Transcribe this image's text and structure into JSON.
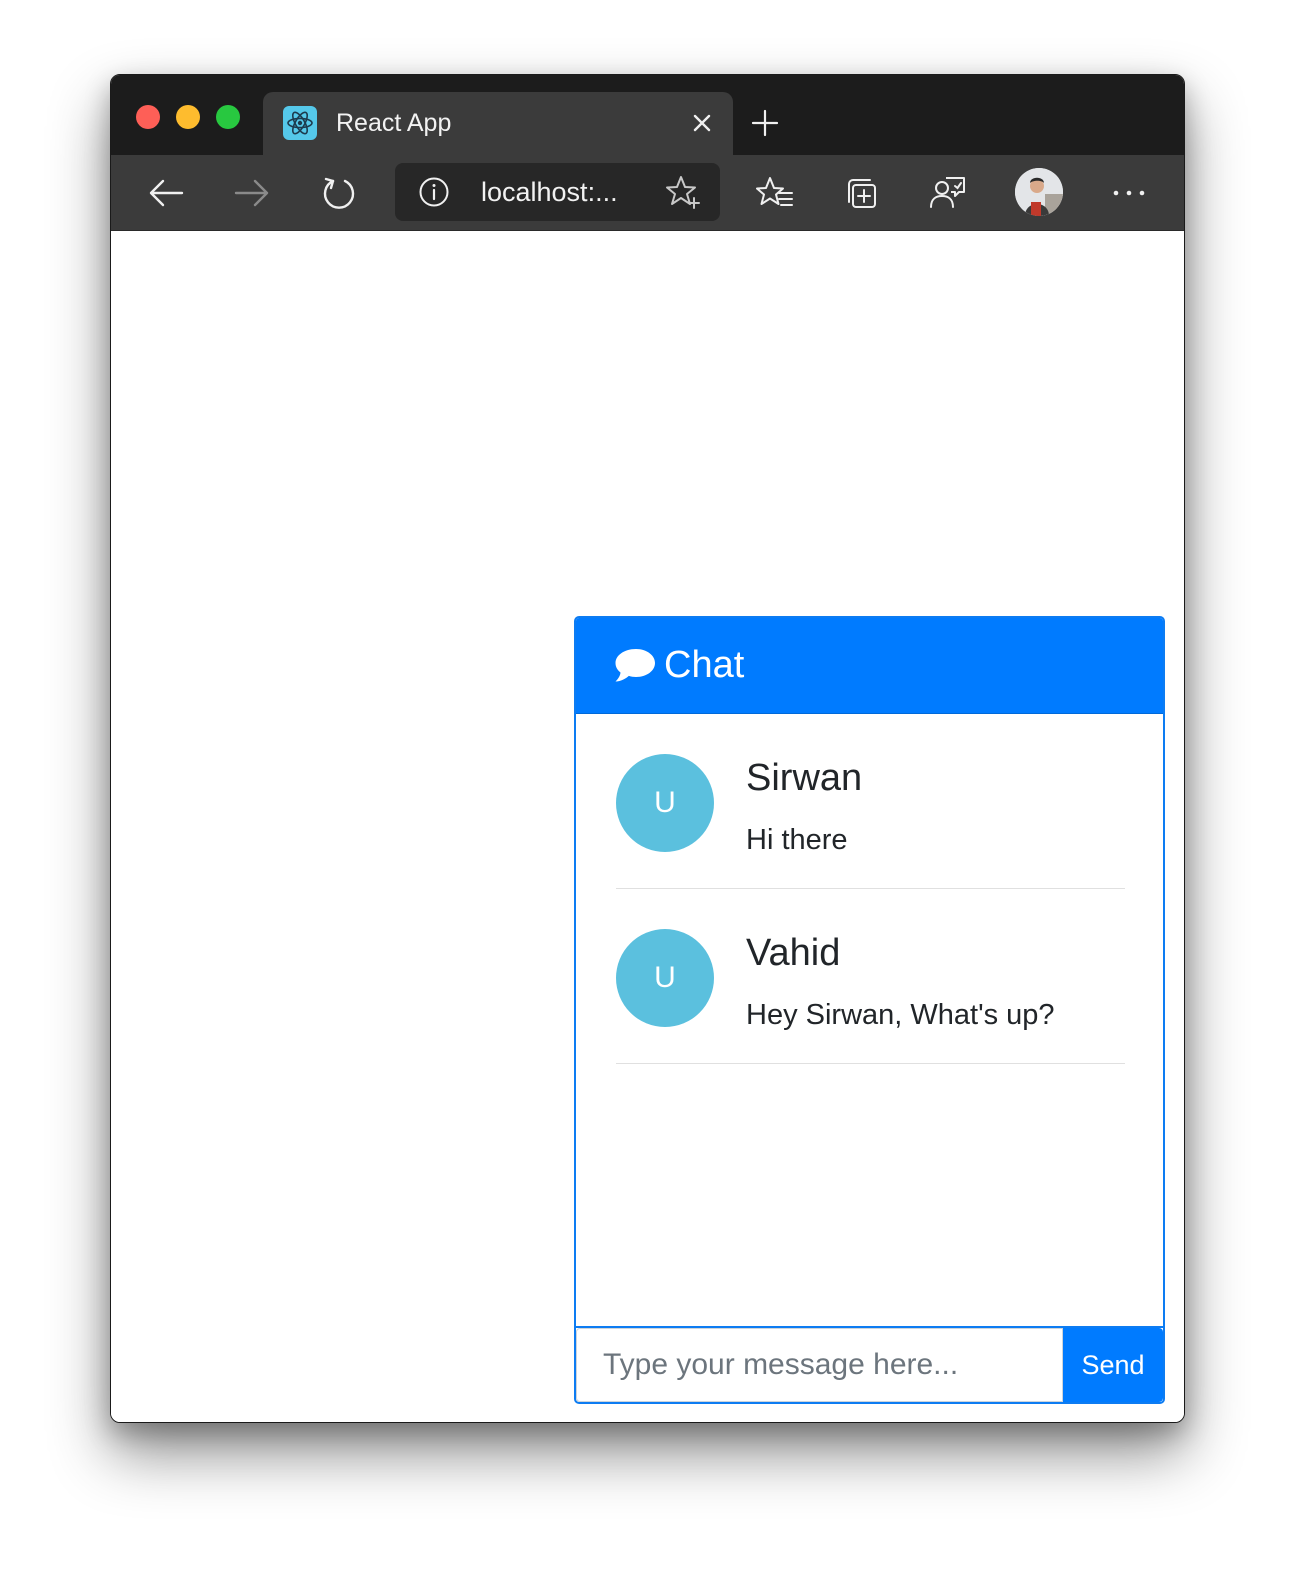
{
  "browser": {
    "tab": {
      "title": "React App",
      "favicon": "react-logo-icon"
    },
    "address": {
      "url": "localhost:..."
    },
    "toolbar_icons": [
      "back-arrow-icon",
      "forward-arrow-icon",
      "reload-icon",
      "info-icon",
      "add-favorite-star-icon",
      "favorites-icon",
      "collections-icon",
      "feedback-icon",
      "profile-avatar",
      "more-icon"
    ]
  },
  "chat": {
    "title": "Chat",
    "header_icon": "speech-bubble-icon",
    "accent_color": "#007bff",
    "avatar_color": "#5bc0de",
    "messages": [
      {
        "avatar": "U",
        "author": "Sirwan",
        "text": "Hi there"
      },
      {
        "avatar": "U",
        "author": "Vahid",
        "text": "Hey Sirwan, What's up?"
      }
    ],
    "input": {
      "placeholder": "Type your message here...",
      "value": ""
    },
    "send_label": "Send"
  }
}
